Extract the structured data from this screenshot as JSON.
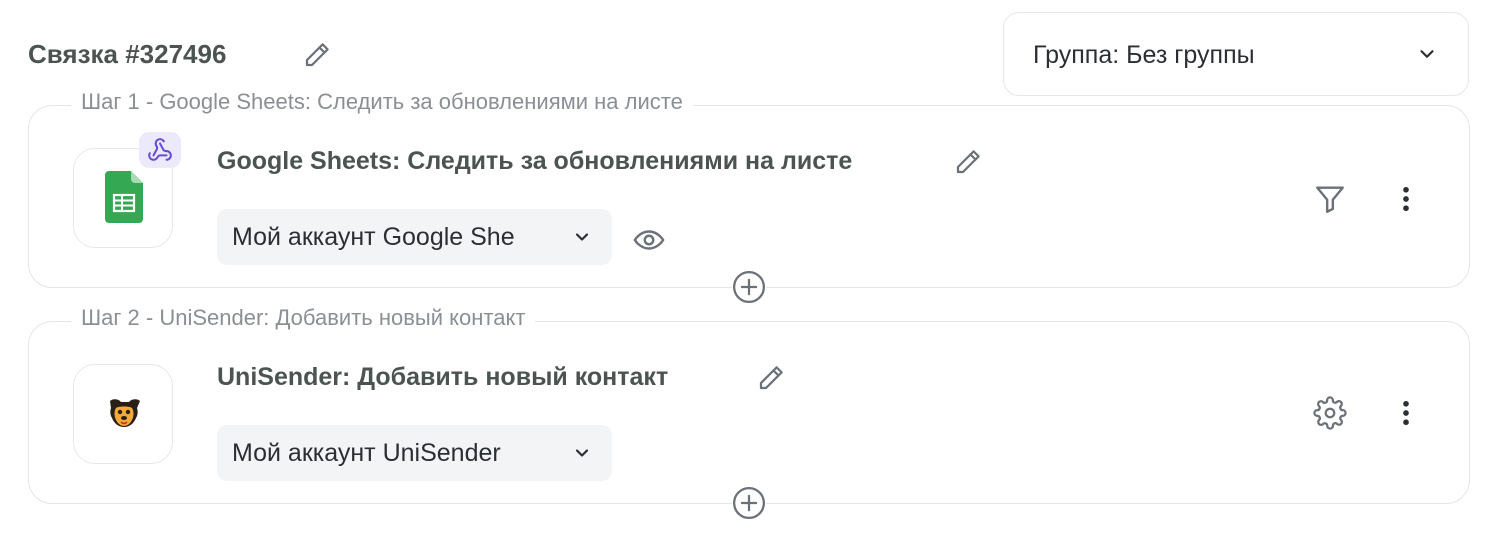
{
  "header": {
    "bundle_title": "Связка #327496",
    "group_select": {
      "label": "Группа: Без группы"
    }
  },
  "steps": [
    {
      "legend": "Шаг 1 - Google Sheets: Следить за обновлениями на листе",
      "action_title": "Google Sheets: Следить за обновлениями на листе",
      "account": "Мой аккаунт Google She",
      "app_icon": "google-sheets-icon",
      "badge_icon": "webhook-icon",
      "right_icon": "filter-icon"
    },
    {
      "legend": "Шаг 2 - UniSender: Добавить новый контакт",
      "action_title": "UniSender: Добавить новый контакт",
      "account": "Мой аккаунт UniSender",
      "app_icon": "unisender-icon",
      "right_icon": "gear-icon"
    }
  ],
  "colors": {
    "text_dark": "#4b5450",
    "icon_gray": "#6b7178",
    "sheets_green": "#34a853",
    "webhook_purple": "#6a4cd6",
    "badge_bg": "#ece9fb"
  }
}
